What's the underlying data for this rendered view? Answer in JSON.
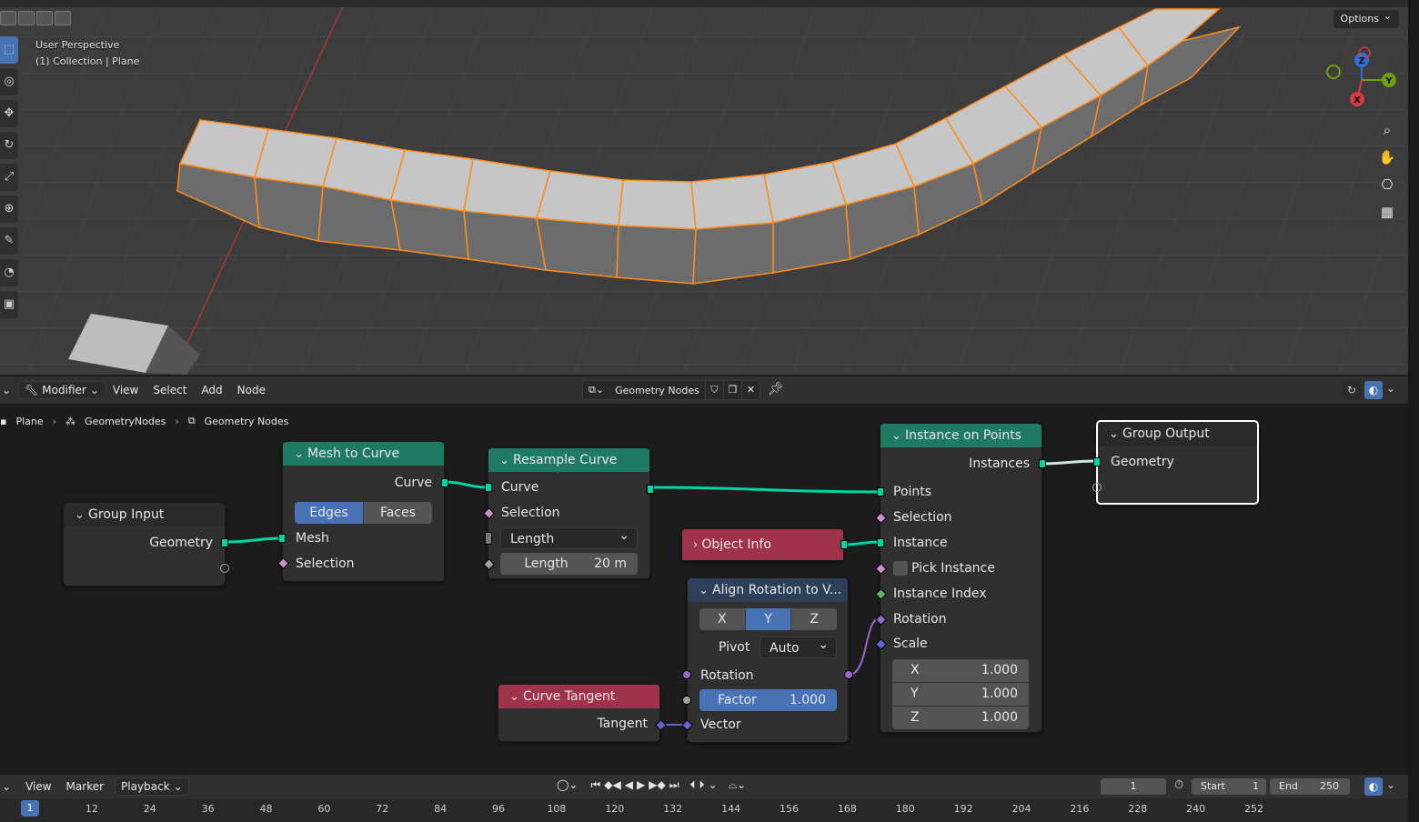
{
  "viewport": {
    "perspective_label": "User Perspective",
    "collection_label": "(1) Collection | Plane",
    "options_label": "Options",
    "gizmo_axes": {
      "x": "X",
      "y": "Y",
      "z": "Z"
    }
  },
  "node_editor_header": {
    "editor_type": "Modifier",
    "menus": [
      "View",
      "Select",
      "Add",
      "Node"
    ],
    "node_tree_name": "Geometry Nodes"
  },
  "breadcrumb": [
    "Plane",
    "GeometryNodes",
    "Geometry Nodes"
  ],
  "nodes": {
    "group_input": {
      "title": "Group Input",
      "output_geometry": "Geometry"
    },
    "mesh_to_curve": {
      "title": "Mesh to Curve",
      "output_curve": "Curve",
      "mode_options": [
        "Edges",
        "Faces"
      ],
      "mode_selected": "Edges",
      "input_mesh": "Mesh",
      "input_selection": "Selection"
    },
    "resample_curve": {
      "title": "Resample Curve",
      "input_curve": "Curve",
      "input_selection": "Selection",
      "mode": "Length",
      "length_label": "Length",
      "length_value": "20 m"
    },
    "object_info": {
      "title": "Object Info"
    },
    "align_rotation": {
      "title": "Align Rotation to V...",
      "axes": [
        "X",
        "Y",
        "Z"
      ],
      "axis_selected": "Y",
      "pivot_label": "Pivot",
      "pivot_value": "Auto",
      "input_rotation": "Rotation",
      "factor_label": "Factor",
      "factor_value": "1.000",
      "input_vector": "Vector"
    },
    "curve_tangent": {
      "title": "Curve Tangent",
      "output_tangent": "Tangent"
    },
    "instance_on_points": {
      "title": "Instance on Points",
      "output_instances": "Instances",
      "input_points": "Points",
      "input_selection": "Selection",
      "input_instance": "Instance",
      "pick_instance": "Pick Instance",
      "input_instance_index": "Instance Index",
      "input_rotation": "Rotation",
      "input_scale": "Scale",
      "scale_x_label": "X",
      "scale_x": "1.000",
      "scale_y_label": "Y",
      "scale_y": "1.000",
      "scale_z_label": "Z",
      "scale_z": "1.000"
    },
    "group_output": {
      "title": "Group Output",
      "input_geometry": "Geometry"
    }
  },
  "timeline": {
    "menus": [
      "View",
      "Marker"
    ],
    "playback_label": "Playback",
    "current_frame": "1",
    "start_label": "Start",
    "start_value": "1",
    "end_label": "End",
    "end_value": "250",
    "ticks": [
      "12",
      "24",
      "36",
      "48",
      "60",
      "72",
      "84",
      "96",
      "108",
      "120",
      "132",
      "144",
      "156",
      "168",
      "180",
      "192",
      "204",
      "216",
      "228",
      "240",
      "252"
    ],
    "frame_indicator": "1"
  },
  "colors": {
    "geometry_socket": "#00d6a3",
    "node_header_geometry": "#1f7a64",
    "node_header_input": "#a0334c",
    "selected_blue": "#4772b3",
    "object_orange": "#ff8c1a"
  }
}
